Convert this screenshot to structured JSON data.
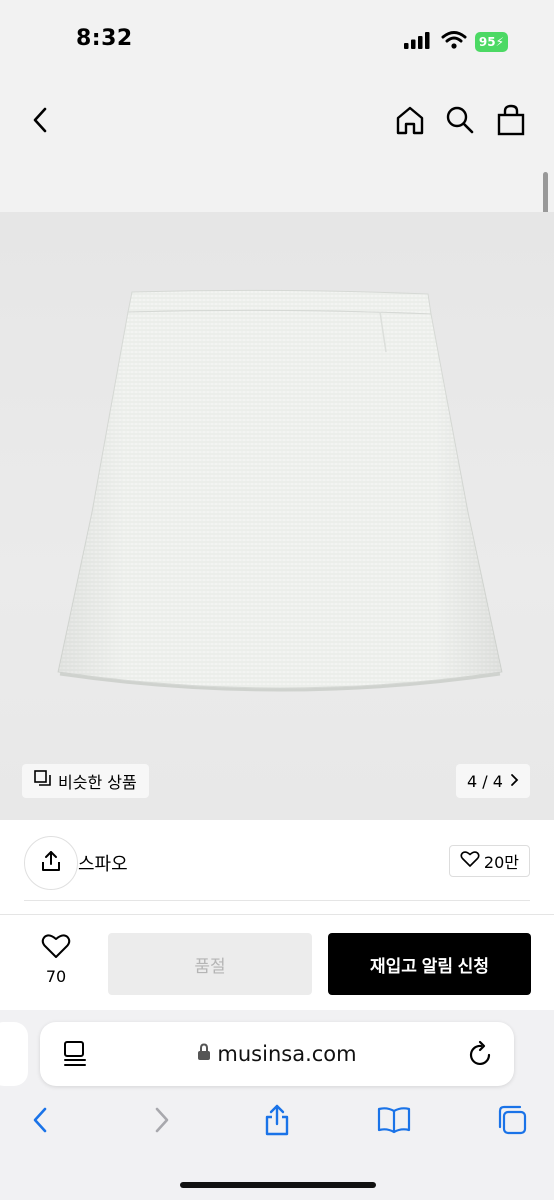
{
  "status": {
    "time": "8:32",
    "battery": "95"
  },
  "header": {
    "back_icon": "chevron-left-icon",
    "home_icon": "home-icon",
    "search_icon": "search-icon",
    "cart_icon": "shopping-bag-icon"
  },
  "gallery": {
    "similar_label": "비슷한 상품",
    "page_counter": "4 / 4"
  },
  "product": {
    "brand": "스파오",
    "likes": "20만"
  },
  "actions": {
    "wish_count": "70",
    "soldout_label": "품절",
    "restock_label": "재입고 알림 신청"
  },
  "browser": {
    "url": "musinsa.com"
  },
  "colors": {
    "accent_black": "#000000",
    "battery_green": "#4cd964",
    "safari_blue": "#1a73e8"
  }
}
